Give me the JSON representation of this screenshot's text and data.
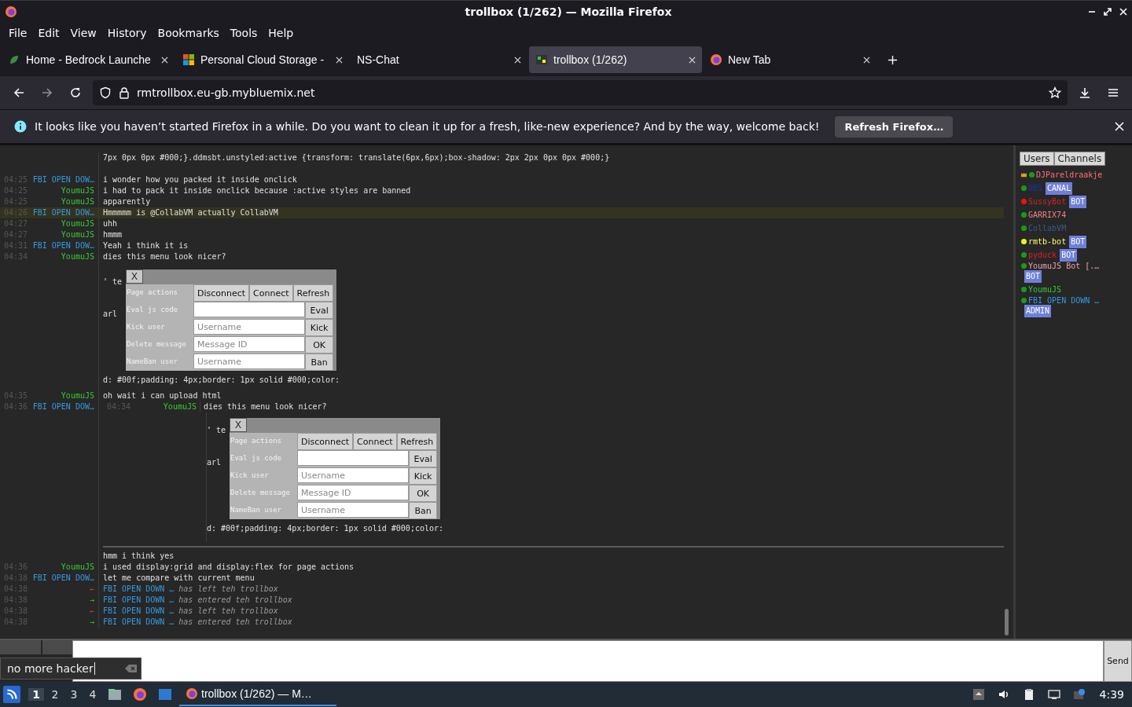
{
  "window": {
    "title": "trollbox (1/262) — Mozilla Firefox"
  },
  "menu_bar": [
    "File",
    "Edit",
    "View",
    "History",
    "Bookmarks",
    "Tools",
    "Help"
  ],
  "tabs": [
    {
      "label": "Home - Bedrock Launche",
      "kind": "launcher",
      "selected": false
    },
    {
      "label": "Personal Cloud Storage -",
      "kind": "cloud",
      "selected": false
    },
    {
      "label": "NS-Chat",
      "kind": "blank",
      "selected": false
    },
    {
      "label": "trollbox (1/262)",
      "kind": "trollbox",
      "selected": true
    },
    {
      "label": "New Tab",
      "kind": "firefox",
      "selected": false
    }
  ],
  "url": "rmtrollbox.eu-gb.mybluemix.net",
  "notification": {
    "text": "It looks like you haven’t started Firefox in a while. Do you want to clean it up for a fresh, like-new experience? And by the way, welcome back!",
    "button": "Refresh Firefox…"
  },
  "chat": {
    "messages": [
      {
        "kind": "continuation",
        "text": "7px 0px 0px #000;}.ddmsbt.unstyled:active {transform: translate(6px,6px);box-shadow: 2px 2px 0px 0px #000;}",
        "highlighted": false
      },
      {
        "kind": "gap"
      },
      {
        "kind": "message",
        "time": "04:25",
        "name": "FBI OPEN DOW…",
        "color": "#3399dd",
        "text": "i wonder how you packed it inside onclick",
        "highlighted": false
      },
      {
        "kind": "message",
        "time": "04:25",
        "name": "YoumuJS",
        "color": "#33cc33",
        "text": "i had to pack it inside onclick because :active styles are banned",
        "highlighted": false
      },
      {
        "kind": "message",
        "time": "04:25",
        "name": "YoumuJS",
        "color": "#33cc33",
        "text": "apparently",
        "highlighted": false
      },
      {
        "kind": "message",
        "time": "04:26",
        "name": "FBI OPEN DOW…",
        "color": "#3399dd",
        "text": "Hmmmmm is @CollabVM actually CollabVM",
        "highlighted": true
      },
      {
        "kind": "message",
        "time": "04:27",
        "name": "YoumuJS",
        "color": "#33cc33",
        "text": "uhh",
        "highlighted": false
      },
      {
        "kind": "message",
        "time": "04:27",
        "name": "YoumuJS",
        "color": "#33cc33",
        "text": "hmmm",
        "highlighted": false
      },
      {
        "kind": "message",
        "time": "04:31",
        "name": "FBI OPEN DOW…",
        "color": "#3399dd",
        "text": "Yeah i think it is",
        "highlighted": false
      },
      {
        "kind": "message",
        "time": "04:34",
        "name": "YoumuJS",
        "color": "#33cc33",
        "text": "dies this menu look nicer?",
        "highlighted": false
      },
      {
        "kind": "menu",
        "quoted": false,
        "frag_top": "' te",
        "frag_mid": "arl",
        "frag_bottom": "d: #00f;padding: 4px;border: 1px solid #000;color:",
        "close": "X",
        "actions_label": "Page actions",
        "actions": [
          "Disconnect",
          "Connect",
          "Refresh"
        ],
        "rows": [
          {
            "label": "Eval js code",
            "button": "Eval"
          },
          {
            "label": "Kick user",
            "placeholder": "Username",
            "button": "Kick"
          },
          {
            "label": "Delete message",
            "placeholder": "Message ID",
            "button": "OK"
          },
          {
            "label": "NameBan user",
            "placeholder": "Username",
            "button": "Ban"
          }
        ]
      },
      {
        "kind": "message",
        "time": "04:35",
        "name": "YoumuJS",
        "color": "#33cc33",
        "text": "oh wait i can upload html",
        "highlighted": false
      },
      {
        "kind": "quote",
        "time": "04:36",
        "name": "FBI OPEN DOW…",
        "color": "#3399dd",
        "quote": {
          "time": "04:34",
          "name": "YoumuJS",
          "color": "#33cc33"
        },
        "text": "dies this menu look nicer?",
        "highlighted": false
      },
      {
        "kind": "menu",
        "quoted": true,
        "frag_top": "' te",
        "frag_mid": "arl",
        "frag_bottom": "d: #00f;padding: 4px;border: 1px solid #000;color:",
        "close": "X",
        "actions_label": "Page actions",
        "actions": [
          "Disconnect",
          "Connect",
          "Refresh"
        ],
        "rows": [
          {
            "label": "Eval js code",
            "button": "Eval"
          },
          {
            "label": "Kick user",
            "placeholder": "Username",
            "button": "Kick"
          },
          {
            "label": "Delete message",
            "placeholder": "Message ID",
            "button": "OK"
          },
          {
            "label": "NameBan user",
            "placeholder": "Username",
            "button": "Ban"
          }
        ]
      },
      {
        "kind": "divider"
      },
      {
        "kind": "continuation",
        "text": "hmm i think yes",
        "highlighted": false
      },
      {
        "kind": "message",
        "time": "04:36",
        "name": "YoumuJS",
        "color": "#33cc33",
        "text": "i used display:grid and display:flex for page actions",
        "highlighted": false
      },
      {
        "kind": "message",
        "time": "04:38",
        "name": "FBI OPEN DOW…",
        "color": "#3399dd",
        "text": "let me compare with current menu",
        "highlighted": false
      },
      {
        "kind": "leave",
        "time": "04:38",
        "arrow": "←",
        "name": "FBI OPEN DOWN …",
        "color": "#3399dd",
        "text": "has left teh trollbox"
      },
      {
        "kind": "join",
        "time": "04:38",
        "arrow": "→",
        "name": "FBI OPEN DOWN …",
        "color": "#3399dd",
        "text": "has entered teh trollbox"
      },
      {
        "kind": "leave",
        "time": "04:38",
        "arrow": "←",
        "name": "FBI OPEN DOWN …",
        "color": "#3399dd",
        "text": "has left teh trollbox"
      },
      {
        "kind": "join",
        "time": "04:38",
        "arrow": "→",
        "name": "FBI OPEN DOWN …",
        "color": "#3399dd",
        "text": "has entered teh trollbox"
      }
    ]
  },
  "sidebar": {
    "tabs": [
      "Users",
      "Channels"
    ],
    "users": [
      {
        "name": "DJPareldraakje",
        "color": "#ff7070",
        "status": {
          "color": "#1a9a1a"
        },
        "crown": true
      },
      {
        "name": "NBS",
        "color": "#2030a0",
        "status": {
          "color": "#1a9a1a"
        },
        "crown": false,
        "badge": "CANAL"
      },
      {
        "name": "SussyBot",
        "color": "#dd2020",
        "status": {
          "color": "#ee1111"
        },
        "crown": false,
        "badge": "BOT"
      },
      {
        "name": "GARRIX74",
        "color": "#f08080",
        "status": {
          "color": "#1a9a1a"
        },
        "crown": false
      },
      {
        "name": "CollabVM",
        "color": "#3a5a8a",
        "status": {
          "color": "#1a9a1a"
        },
        "crown": false
      },
      {
        "name": "rmtb-bot",
        "color": "#ffff66",
        "status": {
          "color": "#eeee22"
        },
        "crown": false,
        "badge": "BOT"
      },
      {
        "name": "pyduck",
        "color": "#dd2020",
        "status": {
          "color": "#1a9a1a"
        },
        "crown": false,
        "badge": "BOT"
      },
      {
        "name": "YoumuJS Bot [.…",
        "color": "#f0a0a0",
        "status": {
          "color": "#1a9a1a"
        },
        "crown": false,
        "badge": "BOT"
      },
      {
        "name": "YoumuJS",
        "color": "#33cc33",
        "status": {
          "color": "#1a9a1a"
        },
        "crown": false
      },
      {
        "name": "FBI OPEN DOWN …",
        "color": "#3399dd",
        "status": {
          "color": "#1a9a1a"
        },
        "crown": false,
        "badge": "ADMIN"
      }
    ]
  },
  "input": {
    "send": "Send",
    "suggestion": "no more hacker"
  },
  "taskbar": {
    "workspaces": [
      {
        "label": "1",
        "selected": true
      },
      {
        "label": "2",
        "selected": false
      },
      {
        "label": "3",
        "selected": false
      },
      {
        "label": "4",
        "selected": false
      }
    ],
    "task": "trollbox (1/262) — M…",
    "clock": "4:39"
  }
}
